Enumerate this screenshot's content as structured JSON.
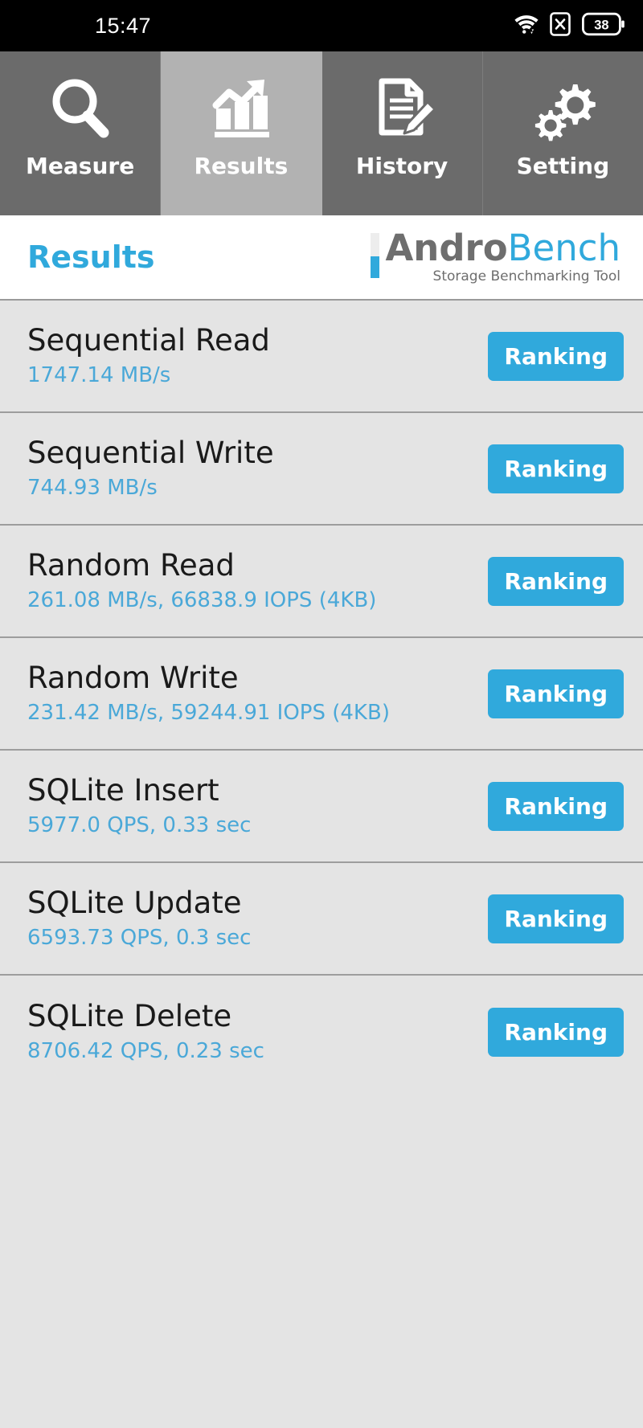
{
  "statusbar": {
    "time": "15:47",
    "icons": [
      {
        "name": "wifi-icon",
        "label": "wifi"
      },
      {
        "name": "no-sim-icon",
        "label": "x"
      },
      {
        "name": "battery-icon",
        "label": "38"
      }
    ],
    "battery_level": "38"
  },
  "tabs": [
    {
      "label": "Measure",
      "icon": "magnifier-icon",
      "active": false
    },
    {
      "label": "Results",
      "icon": "bar-chart-arrow-icon",
      "active": true
    },
    {
      "label": "History",
      "icon": "document-pencil-icon",
      "active": false
    },
    {
      "label": "Setting",
      "icon": "gears-icon",
      "active": false
    }
  ],
  "header": {
    "title": "Results",
    "brand_primary": "Andro",
    "brand_secondary": "Bench",
    "brand_tagline": "Storage Benchmarking Tool"
  },
  "colors": {
    "accent_blue": "#30a9dc",
    "value_blue": "#4aa8d8",
    "tab_inactive": "#6b6b6b",
    "tab_active": "#b2b2b2",
    "list_bg": "#e4e4e4",
    "statusbar_bg": "#000000"
  },
  "results": [
    {
      "name": "Sequential Read",
      "value": "1747.14 MB/s",
      "button": "Ranking"
    },
    {
      "name": "Sequential Write",
      "value": "744.93 MB/s",
      "button": "Ranking"
    },
    {
      "name": "Random Read",
      "value": "261.08 MB/s, 66838.9 IOPS (4KB)",
      "button": "Ranking"
    },
    {
      "name": "Random Write",
      "value": "231.42 MB/s, 59244.91 IOPS (4KB)",
      "button": "Ranking"
    },
    {
      "name": "SQLite Insert",
      "value": "5977.0 QPS, 0.33 sec",
      "button": "Ranking"
    },
    {
      "name": "SQLite Update",
      "value": "6593.73 QPS, 0.3 sec",
      "button": "Ranking"
    },
    {
      "name": "SQLite Delete",
      "value": "8706.42 QPS, 0.23 sec",
      "button": "Ranking"
    }
  ]
}
